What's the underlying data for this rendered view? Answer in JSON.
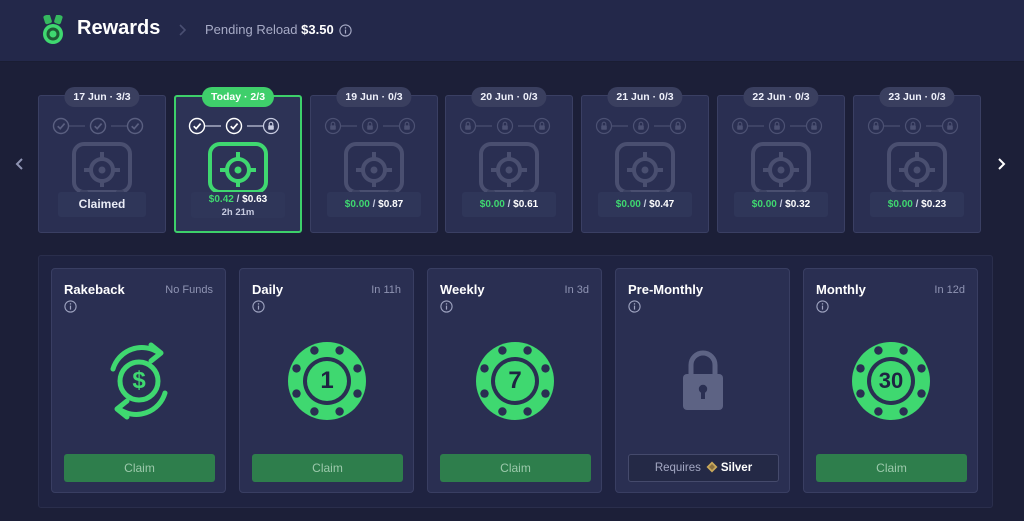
{
  "header": {
    "title": "Rewards",
    "pending_label": "Pending Reload",
    "pending_value": "$3.50"
  },
  "days": [
    {
      "label": "17 Jun · 3/3",
      "state": "claimed",
      "steps": [
        "done",
        "done",
        "done"
      ],
      "status_text": "Claimed"
    },
    {
      "label": "Today · 2/3",
      "state": "today",
      "steps": [
        "done",
        "done",
        "locked"
      ],
      "current": "$0.42",
      "separator": "/",
      "max": "$0.63",
      "timer": "2h 21m"
    },
    {
      "label": "19 Jun · 0/3",
      "state": "locked",
      "steps": [
        "locked",
        "locked",
        "locked"
      ],
      "current": "$0.00",
      "separator": "/",
      "max": "$0.87"
    },
    {
      "label": "20 Jun · 0/3",
      "state": "locked",
      "steps": [
        "locked",
        "locked",
        "locked"
      ],
      "current": "$0.00",
      "separator": "/",
      "max": "$0.61"
    },
    {
      "label": "21 Jun · 0/3",
      "state": "locked",
      "steps": [
        "locked",
        "locked",
        "locked"
      ],
      "current": "$0.00",
      "separator": "/",
      "max": "$0.47"
    },
    {
      "label": "22 Jun · 0/3",
      "state": "locked",
      "steps": [
        "locked",
        "locked",
        "locked"
      ],
      "current": "$0.00",
      "separator": "/",
      "max": "$0.32"
    },
    {
      "label": "23 Jun · 0/3",
      "state": "locked",
      "steps": [
        "locked",
        "locked",
        "locked"
      ],
      "current": "$0.00",
      "separator": "/",
      "max": "$0.23"
    }
  ],
  "rewards": [
    {
      "title": "Rakeback",
      "status": "No Funds",
      "icon": "rakeback-dollar-icon",
      "button": "Claim"
    },
    {
      "title": "Daily",
      "status": "In 11h",
      "icon": "chip-icon",
      "chip_value": "1",
      "button": "Claim"
    },
    {
      "title": "Weekly",
      "status": "In 3d",
      "icon": "chip-icon",
      "chip_value": "7",
      "button": "Claim"
    },
    {
      "title": "Pre-Monthly",
      "status": "",
      "icon": "lock-icon",
      "requires_label": "Requires",
      "requires_tier": "Silver"
    },
    {
      "title": "Monthly",
      "status": "In 12d",
      "icon": "chip-icon",
      "chip_value": "30",
      "button": "Claim"
    }
  ],
  "colors": {
    "accent_green": "#3fd870",
    "claim_button": "#2e7e4c",
    "background": "#1c1f38",
    "card": "#2a2f52",
    "silver_diamond": "#c9a85a"
  }
}
